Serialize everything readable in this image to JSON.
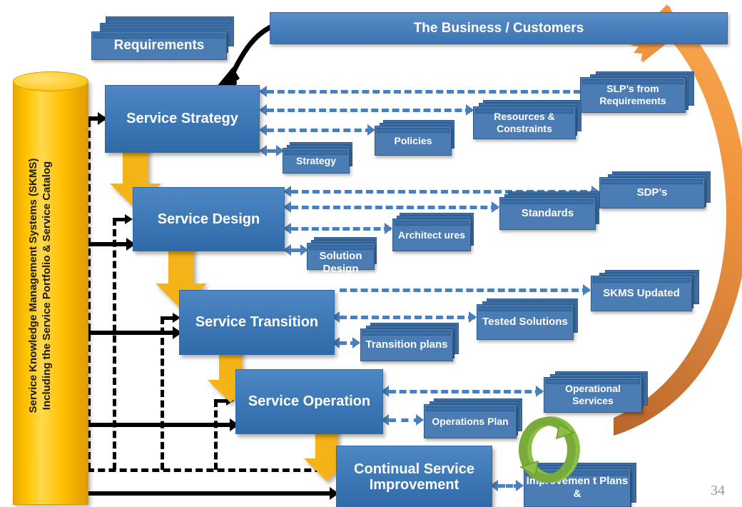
{
  "slide": {
    "number": "34"
  },
  "banner": {
    "label": "The Business / Customers"
  },
  "requirements": {
    "label": "Requirements"
  },
  "knowledge_cylinder": {
    "line1": "Service Knowledge Management Systems (SKMS)",
    "line2": "Including the Service Portfolio & Service Catalog"
  },
  "lifecycle": {
    "stages": [
      {
        "id": "service-strategy",
        "label": "Service Strategy"
      },
      {
        "id": "service-design",
        "label": "Service Design"
      },
      {
        "id": "service-transition",
        "label": "Service Transition"
      },
      {
        "id": "service-operation",
        "label": "Service Operation"
      },
      {
        "id": "continual-service-improvement",
        "label": "Continual Service Improvement"
      }
    ]
  },
  "outputs": {
    "strategy_row": [
      {
        "id": "slps-from-requirements",
        "label": "SLP’s from Requirements"
      },
      {
        "id": "resources-constraints",
        "label": "Resources & Constraints"
      },
      {
        "id": "policies",
        "label": "Policies"
      },
      {
        "id": "strategy",
        "label": "Strategy"
      }
    ],
    "design_row": [
      {
        "id": "sdps",
        "label": "SDP’s"
      },
      {
        "id": "standards",
        "label": "Standards"
      },
      {
        "id": "architectures",
        "label": "Architect ures"
      },
      {
        "id": "solution-design",
        "label": "Solution Design"
      }
    ],
    "transition_row": [
      {
        "id": "skms-updated",
        "label": "SKMS Updated"
      },
      {
        "id": "tested-solutions",
        "label": "Tested Solutions"
      },
      {
        "id": "transition-plans",
        "label": "Transition plans"
      }
    ],
    "operation_row": [
      {
        "id": "operational-services",
        "label": "Operational Services"
      },
      {
        "id": "operations-plan",
        "label": "Operations Plan"
      }
    ],
    "csi_row": [
      {
        "id": "improvement-plans",
        "label": "Improvemen t Plans &"
      }
    ]
  },
  "colors": {
    "stage_blue": "#3f7ab8",
    "banner_blue": "#4a80bd",
    "card_blue": "#4b7db4",
    "dashed_blue": "#4a7fbd",
    "cylinder_yellow": "#ffc400",
    "flow_arrow_yellow": "#f5b317",
    "feedback_orange": "#f0933c",
    "cycle_green": "#8cbf46",
    "connector_black": "#000000"
  },
  "icons": {
    "requirements_flow": "curved-black-arrow-icon",
    "customer_feedback_loop": "orange-curved-arrow-icon",
    "improvement_cycle": "green-circular-arrows-icon"
  }
}
